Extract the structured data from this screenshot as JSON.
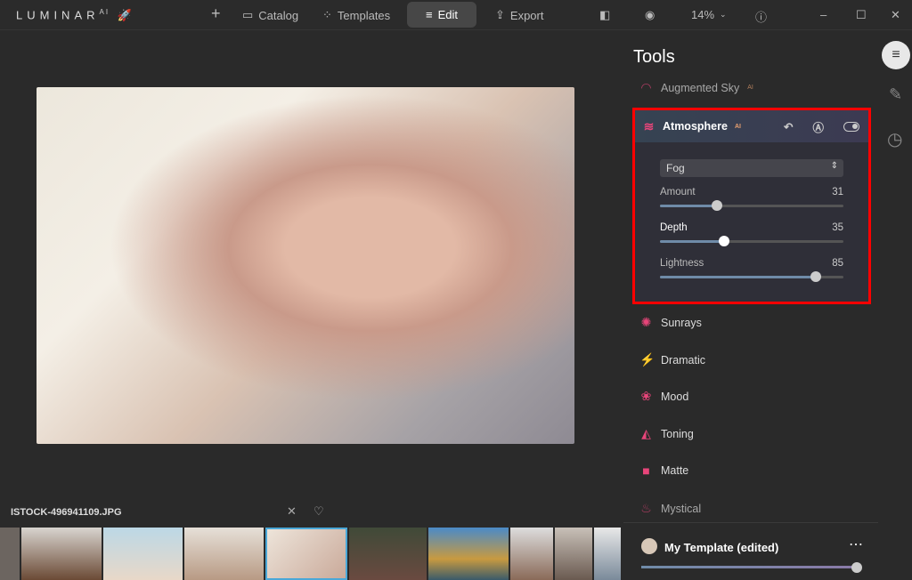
{
  "app": {
    "logo": "LUMINAR",
    "logo_sup": "AI"
  },
  "nav": {
    "add": "+",
    "catalog": "Catalog",
    "templates": "Templates",
    "edit": "Edit",
    "export": "Export",
    "zoom": "14%"
  },
  "file_name": "ISTOCK-496941109.JPG",
  "tools": {
    "title": "Tools",
    "augmented_sky": "Augmented Sky",
    "ai": "AI",
    "atmosphere": {
      "title": "Atmosphere",
      "ai": "AI",
      "mode": "Fog",
      "sliders": [
        {
          "label": "Amount",
          "value": 31
        },
        {
          "label": "Depth",
          "value": 35
        },
        {
          "label": "Lightness",
          "value": 85
        }
      ]
    },
    "items": [
      "Sunrays",
      "Dramatic",
      "Mood",
      "Toning",
      "Matte",
      "Mystical"
    ]
  },
  "template": {
    "name": "My Template (edited)",
    "amount": 100
  },
  "colors": {
    "accent": "#e8457a",
    "highlight": "#ff0000"
  }
}
